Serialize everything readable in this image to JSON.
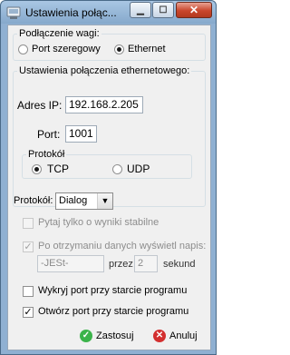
{
  "window": {
    "title": "Ustawienia połąc..."
  },
  "group_connection": {
    "title": "Podłączenie wagi:",
    "options": [
      {
        "label": "Port szeregowy",
        "selected": false
      },
      {
        "label": "Ethernet",
        "selected": true
      }
    ]
  },
  "group_ethernet": {
    "title": "Ustawienia połączenia ethernetowego:",
    "ip_label": "Adres IP:",
    "ip_value": "192.168.2.205",
    "port_label": "Port:",
    "port_value": "1001",
    "protocol": {
      "title": "Protokół",
      "options": [
        {
          "label": "TCP",
          "selected": true
        },
        {
          "label": "UDP",
          "selected": false
        }
      ]
    }
  },
  "protocol_select": {
    "label": "Protokół:",
    "value": "Dialog"
  },
  "stable_only": {
    "label": "Pytaj tylko o wyniki stabilne",
    "checked": false,
    "enabled": false
  },
  "display_text": {
    "label": "Po otrzymaniu danych wyświetl napis:",
    "checked": true,
    "enabled": false,
    "text_value": "-JESt-",
    "for_label": "przez",
    "seconds_value": "2",
    "seconds_label": "sekund"
  },
  "detect_port": {
    "label": "Wykryj port przy starcie programu",
    "checked": false
  },
  "open_port": {
    "label": "Otwórz port przy starcie programu",
    "checked": true
  },
  "buttons": {
    "apply": "Zastosuj",
    "cancel": "Anuluj"
  },
  "icons": {
    "apply": "green-check-icon",
    "cancel": "red-x-icon"
  }
}
